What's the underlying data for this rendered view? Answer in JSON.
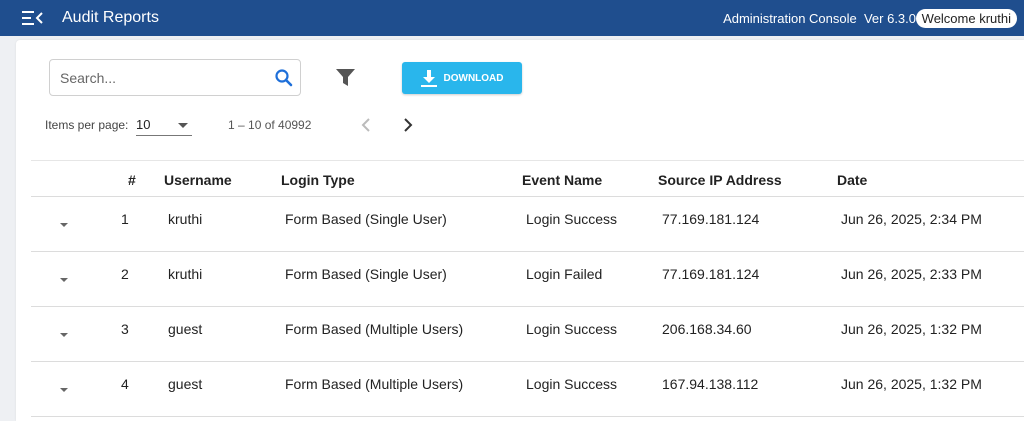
{
  "header": {
    "title": "Audit Reports",
    "console": "Administration Console  Ver 6.3.0",
    "welcome": "Welcome kruthi"
  },
  "toolbar": {
    "search_placeholder": "Search...",
    "download_label": "DOWNLOAD"
  },
  "pagination": {
    "items_per_page_label": "Items per page:",
    "items_per_page_value": "10",
    "range": "1 – 10 of 40992"
  },
  "table": {
    "columns": [
      "#",
      "Username",
      "Login Type",
      "Event Name",
      "Source IP Address",
      "Date"
    ],
    "rows": [
      [
        "1",
        "kruthi",
        "Form Based (Single User)",
        "Login Success",
        "77.169.181.124",
        "Jun 26, 2025, 2:34 PM"
      ],
      [
        "2",
        "kruthi",
        "Form Based (Single User)",
        "Login Failed",
        "77.169.181.124",
        "Jun 26, 2025, 2:33 PM"
      ],
      [
        "3",
        "guest",
        "Form Based (Multiple Users)",
        "Login Success",
        "206.168.34.60",
        "Jun 26, 2025, 1:32 PM"
      ],
      [
        "4",
        "guest",
        "Form Based (Multiple Users)",
        "Login Success",
        "167.94.138.112",
        "Jun 26, 2025, 1:32 PM"
      ]
    ]
  },
  "colors": {
    "header_bg": "#1f4e8e",
    "download_bg": "#29b6ec",
    "search_icon": "#1e6fd9"
  },
  "icons": {
    "menu": "menu-collapse-icon",
    "search": "search-icon",
    "filter": "filter-icon",
    "download": "download-icon",
    "prev": "chevron-left-icon",
    "next": "chevron-right-icon",
    "expand": "caret-down-icon"
  }
}
